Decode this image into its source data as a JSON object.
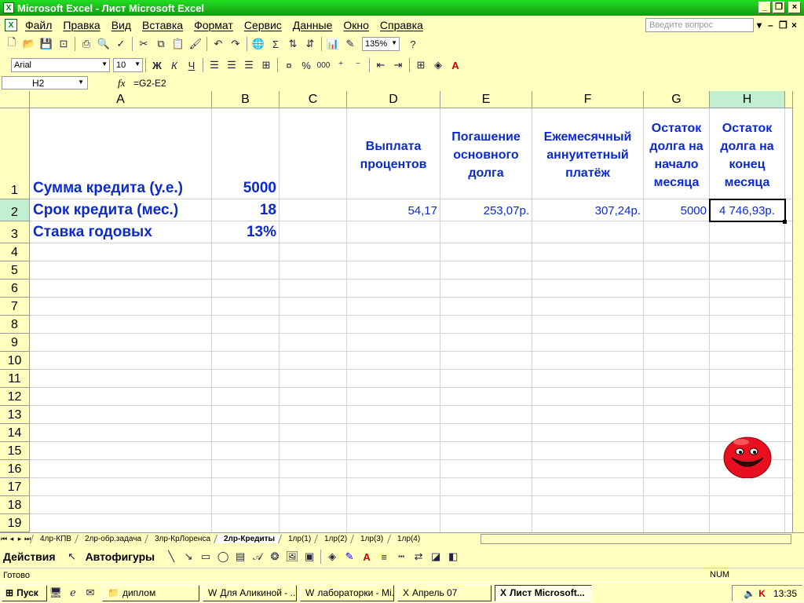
{
  "window": {
    "title": "Microsoft Excel - Лист Microsoft Excel"
  },
  "menu": [
    "Файл",
    "Правка",
    "Вид",
    "Вставка",
    "Формат",
    "Сервис",
    "Данные",
    "Окно",
    "Справка"
  ],
  "ask_placeholder": "Введите вопрос",
  "toolbar": {
    "zoom": "135%",
    "font": "Arial",
    "font_size": "10",
    "bold": "Ж",
    "italic": "К",
    "underline": "Ч",
    "percent": "%",
    "thousands": "000",
    "sum": "Σ"
  },
  "name_box": "H2",
  "formula": "=G2-E2",
  "columns": [
    "A",
    "B",
    "C",
    "D",
    "E",
    "F",
    "G",
    "H"
  ],
  "rows": [
    "1",
    "2",
    "3",
    "4",
    "5",
    "6",
    "7",
    "8",
    "9",
    "10",
    "11",
    "12",
    "13",
    "14",
    "15",
    "16",
    "17",
    "18",
    "19"
  ],
  "cells": {
    "A1": "Сумма кредита (у.е.)",
    "B1": "5000",
    "D1": "Выплата процентов",
    "E1": "Погашение основного долга",
    "F1": "Ежемесячный аннуитетный платёж",
    "G1": "Остаток долга на начало месяца",
    "H1": "Остаток долга на конец месяца",
    "A2": "Срок кредита (мес.)",
    "B2": "18",
    "D2": "54,17",
    "E2": "253,07р.",
    "F2": "307,24р.",
    "G2": "5000",
    "H2": "4 746,93р.",
    "A3": "Ставка годовых",
    "B3": "13%"
  },
  "sheet_tabs": [
    "4лр-КПВ",
    "2лр-обр.задача",
    "3лр-КрЛоренса",
    "2лр-Кредиты",
    "1лр(1)",
    "1лр(2)",
    "1лр(3)",
    "1лр(4)"
  ],
  "active_tab": "2лр-Кредиты",
  "draw": {
    "actions": "Действия",
    "autoshapes": "Автофигуры"
  },
  "status": {
    "ready": "Готово",
    "num": "NUM"
  },
  "taskbar": {
    "start": "Пуск",
    "buttons": [
      "диплом",
      "Для Аликиной - ...",
      "лабораторки - Mi...",
      "Апрель 07",
      "Лист Microsoft..."
    ],
    "clock": "13:35"
  }
}
